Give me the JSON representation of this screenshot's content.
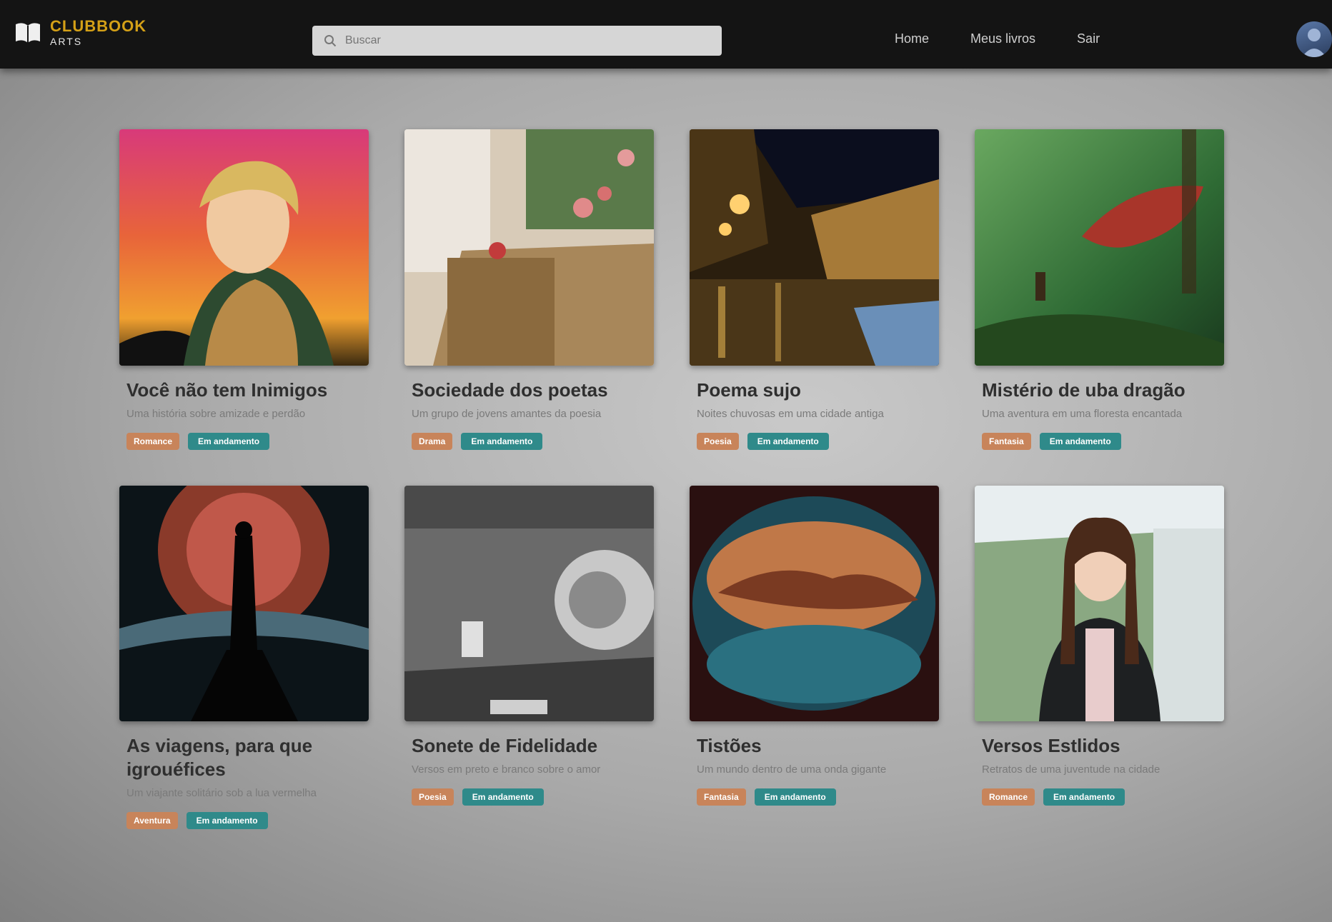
{
  "brand": {
    "title": "CLUBBOOK",
    "subtitle": "ARTS"
  },
  "search": {
    "placeholder": "Buscar"
  },
  "nav": {
    "items": [
      "Home",
      "Meus livros",
      "Sair"
    ]
  },
  "colors": {
    "topbar": "#141414",
    "accent": "#d4a017",
    "tag_genre": "#c8845a",
    "tag_status": "#2f8a8a"
  },
  "cards": [
    {
      "title": "Você não tem Inimigos",
      "description": "Uma história sobre amizade e perdão",
      "tags": [
        "Romance",
        "Em andamento"
      ],
      "image": "anime-blond-man-sunset"
    },
    {
      "title": "Sociedade dos poetas",
      "description": "Um grupo de jovens amantes da poesia",
      "tags": [
        "Drama",
        "Em andamento"
      ],
      "image": "cake-and-roses-still-life"
    },
    {
      "title": "Poema sujo",
      "description": "Noites chuvosas em uma cidade antiga",
      "tags": [
        "Poesia",
        "Em andamento"
      ],
      "image": "rainy-night-street"
    },
    {
      "title": "Mistério de uba dragão",
      "description": "Uma aventura em uma floresta encantada",
      "tags": [
        "Fantasia",
        "Em andamento"
      ],
      "image": "green-forest-red-dragon"
    },
    {
      "title": "As viagens, para que igrouéfices",
      "description": "Um viajante solitário sob a lua vermelha",
      "tags": [
        "Aventura",
        "Em andamento"
      ],
      "image": "silhouette-red-moon"
    },
    {
      "title": "Sonete de Fidelidade",
      "description": "Versos em preto e branco sobre o amor",
      "tags": [
        "Poesia",
        "Em andamento"
      ],
      "image": "black-white-sketch"
    },
    {
      "title": "Tistões",
      "description": "Um mundo dentro de uma onda gigante",
      "tags": [
        "Fantasia",
        "Em andamento"
      ],
      "image": "wave-island-painting"
    },
    {
      "title": "Versos Estlidos",
      "description": "Retratos de uma juventude na cidade",
      "tags": [
        "Romance",
        "Em andamento"
      ],
      "image": "woman-portrait-park"
    }
  ]
}
